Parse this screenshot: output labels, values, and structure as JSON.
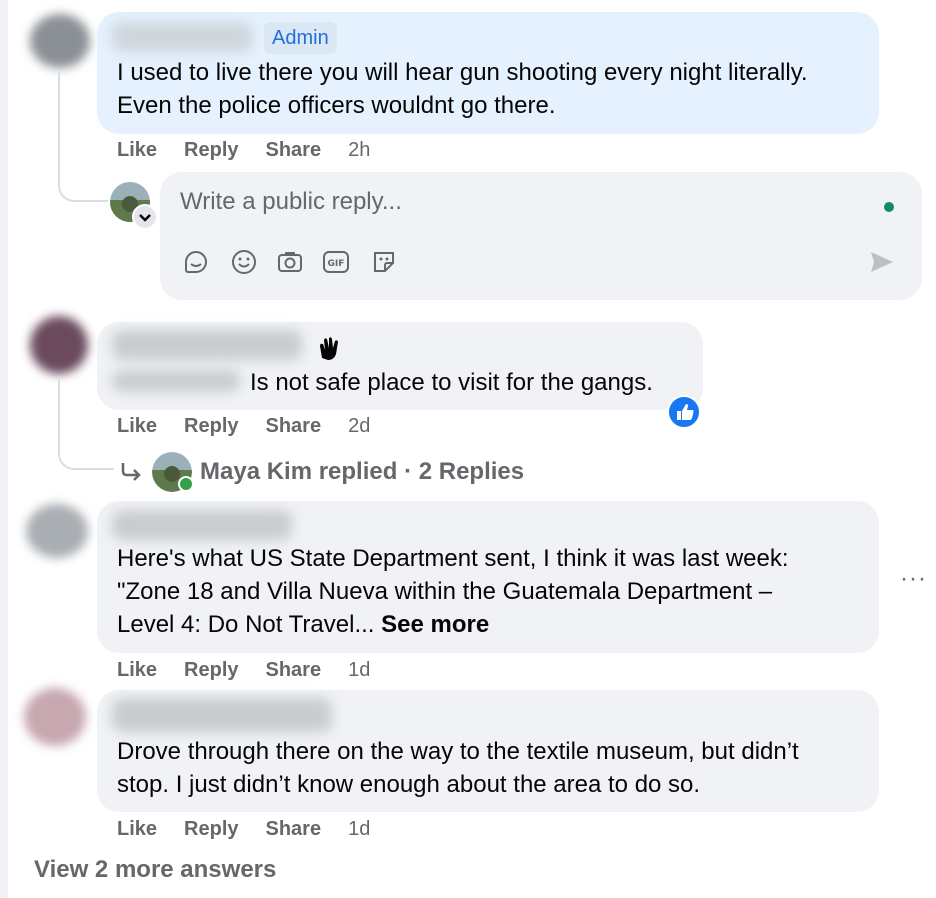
{
  "comments": [
    {
      "badge": "Admin",
      "lines": [
        "I used to live there you will hear gun shooting every night literally.",
        "Even the police officers wouldnt go there."
      ],
      "actions": {
        "like": "Like",
        "reply": "Reply",
        "share": "Share",
        "time": "2h"
      }
    },
    {
      "text": "Is not safe place to visit for the gangs.",
      "actions": {
        "like": "Like",
        "reply": "Reply",
        "share": "Share",
        "time": "2d"
      },
      "replies_summary": "Maya Kim replied · 2 Replies"
    },
    {
      "lines": [
        "Here's what US State Department sent, I think it was last week:",
        "\"Zone 18 and Villa Nueva within the Guatemala Department –",
        "Level 4: Do Not Travel..."
      ],
      "see_more": "See more",
      "actions": {
        "like": "Like",
        "reply": "Reply",
        "share": "Share",
        "time": "1d"
      }
    },
    {
      "lines": [
        "Drove through there on the way to the textile museum, but didn’t",
        "stop. I just didn’t know enough about the area to do so."
      ],
      "actions": {
        "like": "Like",
        "reply": "Reply",
        "share": "Share",
        "time": "1d"
      }
    }
  ],
  "reply_box": {
    "placeholder": "Write a public reply..."
  },
  "view_more": "View 2 more answers",
  "more_options": "···",
  "icons": [
    "avatar-sticker-icon",
    "emoji-icon",
    "camera-icon",
    "gif-icon",
    "sticker-icon",
    "send-icon",
    "wave-emoji",
    "like-reaction-icon",
    "reply-arrow-icon"
  ],
  "colors": {
    "accent": "#1877f2",
    "muted": "#65676b",
    "bubble": "#f0f2f5",
    "admin_bubble": "#e5f1fe",
    "online": "#0f8a63"
  }
}
